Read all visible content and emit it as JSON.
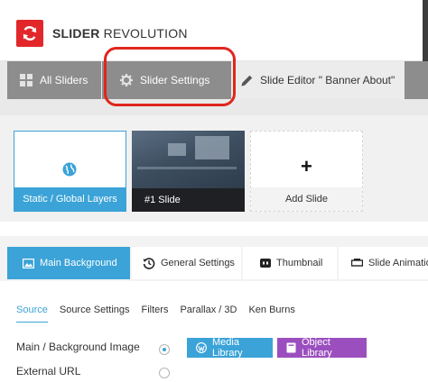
{
  "header": {
    "brand_bold": "SLIDER",
    "brand_rest": "REVOLUTION",
    "logo_color": "#e2272a"
  },
  "nav_tabs": {
    "all_sliders": "All Sliders",
    "slider_settings": "Slider Settings",
    "slide_editor": "Slide Editor \" Banner About\""
  },
  "slides": {
    "static_layers": "Static / Global Layers",
    "slide1": "#1 Slide",
    "add_slide": "Add Slide"
  },
  "settings_tabs": {
    "main_background": "Main Background",
    "general_settings": "General Settings",
    "thumbnail": "Thumbnail",
    "slide_animation": "Slide Animation"
  },
  "sub_tabs": [
    "Source",
    "Source Settings",
    "Filters",
    "Parallax / 3D",
    "Ken Burns"
  ],
  "form": {
    "main_bg_label": "Main / Background Image",
    "external_url_label": "External URL",
    "media_library": "Media Library",
    "object_library": "Object Library"
  },
  "colors": {
    "accent_blue": "#3ba3d7",
    "object_purple": "#9b4fbf",
    "highlight_red": "#e0261e",
    "tab_gray": "#8d8d8d"
  },
  "icons": {
    "logo": "refresh-icon",
    "all_sliders": "grid-icon",
    "slider_settings": "gear-icon",
    "slide_editor": "pencil-icon",
    "static_layers": "globe-icon",
    "add_slide": "plus-icon",
    "main_background": "image-icon",
    "general_settings": "history-icon",
    "thumbnail": "thumbnail-icon",
    "slide_animation": "animation-icon",
    "media_library": "wordpress-icon",
    "object_library": "book-icon"
  }
}
